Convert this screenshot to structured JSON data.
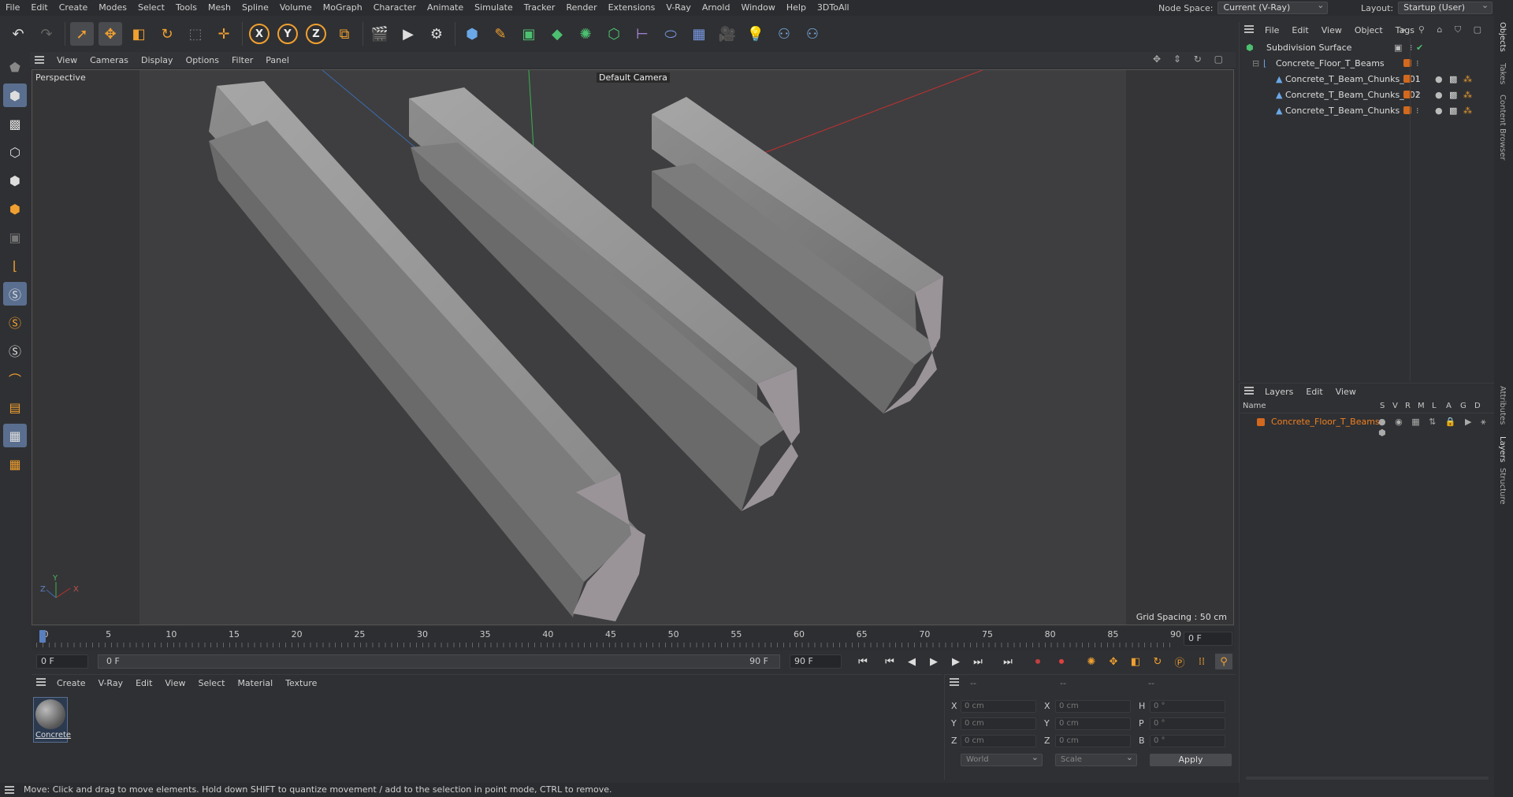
{
  "menubar": {
    "items": [
      "File",
      "Edit",
      "Create",
      "Modes",
      "Select",
      "Tools",
      "Mesh",
      "Spline",
      "Volume",
      "MoGraph",
      "Character",
      "Animate",
      "Simulate",
      "Tracker",
      "Render",
      "Extensions",
      "V-Ray",
      "Arnold",
      "Window",
      "Help",
      "3DToAll"
    ],
    "node_space_label": "Node Space:",
    "node_space_value": "Current (V-Ray)",
    "layout_label": "Layout:",
    "layout_value": "Startup (User)"
  },
  "viewport": {
    "menu": [
      "View",
      "Cameras",
      "Display",
      "Options",
      "Filter",
      "Panel"
    ],
    "view_name": "Perspective",
    "camera": "Default Camera",
    "grid_spacing": "Grid Spacing : 50 cm"
  },
  "timeline": {
    "ticks": [
      "0",
      "5",
      "10",
      "15",
      "20",
      "25",
      "30",
      "35",
      "40",
      "45",
      "50",
      "55",
      "60",
      "65",
      "70",
      "75",
      "80",
      "85",
      "90"
    ],
    "current_frame_right": "0 F"
  },
  "transport": {
    "start_field": "0 F",
    "range_start": "0 F",
    "range_end": "90 F",
    "end_field": "90 F"
  },
  "material_panel": {
    "menu": [
      "Create",
      "V-Ray",
      "Edit",
      "View",
      "Select",
      "Material",
      "Texture"
    ],
    "material_name": "Concrete"
  },
  "coords": {
    "header": [
      "--",
      "--",
      "--"
    ],
    "rows": [
      {
        "l1": "X",
        "v1": "0 cm",
        "l2": "X",
        "v2": "0 cm",
        "l3": "H",
        "v3": "0 °"
      },
      {
        "l1": "Y",
        "v1": "0 cm",
        "l2": "Y",
        "v2": "0 cm",
        "l3": "P",
        "v3": "0 °"
      },
      {
        "l1": "Z",
        "v1": "0 cm",
        "l2": "Z",
        "v2": "0 cm",
        "l3": "B",
        "v3": "0 °"
      }
    ],
    "world": "World",
    "scale": "Scale",
    "apply": "Apply"
  },
  "objects_panel": {
    "menu": [
      "File",
      "Edit",
      "View",
      "Object",
      "Tags"
    ],
    "items": [
      {
        "name": "Subdivision Surface",
        "indent": 0
      },
      {
        "name": "Concrete_Floor_T_Beams",
        "indent": 1
      },
      {
        "name": "Concrete_T_Beam_Chunks_001",
        "indent": 2
      },
      {
        "name": "Concrete_T_Beam_Chunks_002",
        "indent": 2
      },
      {
        "name": "Concrete_T_Beam_Chunks",
        "indent": 2
      }
    ]
  },
  "layers_panel": {
    "menu": [
      "Layers",
      "Edit",
      "View"
    ],
    "col_name": "Name",
    "cols": [
      "S",
      "V",
      "R",
      "M",
      "L",
      "A",
      "G",
      "D"
    ],
    "layer_name": "Concrete_Floor_T_Beams"
  },
  "right_tabs": [
    "Objects",
    "Takes",
    "Content Browser",
    "Attributes",
    "Layers",
    "Structure"
  ],
  "status": "Move: Click and drag to move elements. Hold down SHIFT to quantize movement / add to the selection in point mode, CTRL to remove.",
  "colors": {
    "accent_orange": "#e07820",
    "selection_blue": "#5a6f8f",
    "layer_orange": "#d2691e"
  }
}
